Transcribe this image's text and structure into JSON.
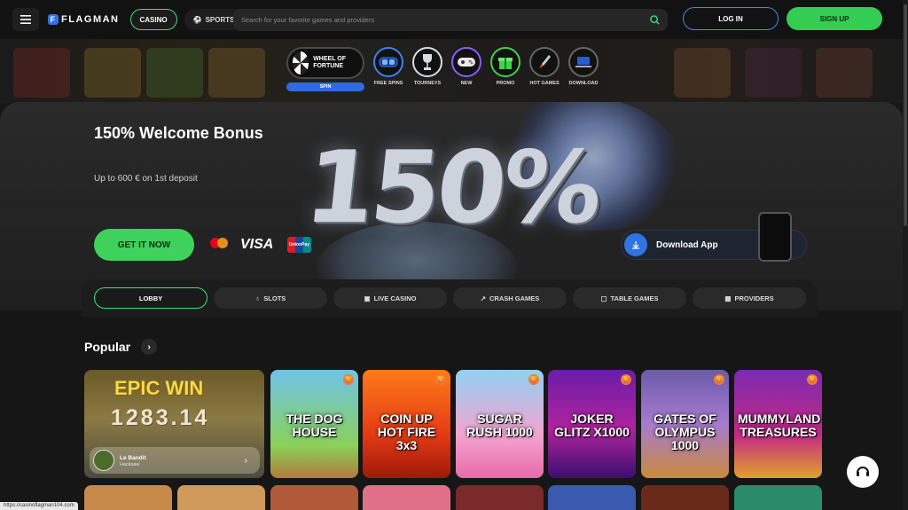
{
  "header": {
    "logo_text": "FLAGMAN",
    "logo_letter": "F",
    "casino_label": "CASINO",
    "sports_label": "SPORTS",
    "search_placeholder": "Search for your favorite games and providers",
    "login_label": "LOG IN",
    "signup_label": "SIGN UP"
  },
  "quick_nav": {
    "wheel_title": "WHEEL OF FORTUNE",
    "wheel_button": "SPIN",
    "items": [
      {
        "label": "FREE SPINS",
        "icon": "goggles-icon",
        "color": "#3b82f6"
      },
      {
        "label": "TOURNEYS",
        "icon": "trophy-icon",
        "color": "#d7dde6"
      },
      {
        "label": "NEW",
        "icon": "gamepad-icon",
        "color": "#8b5cf6"
      },
      {
        "label": "PROMO",
        "icon": "gift-icon",
        "color": "#44d04a"
      },
      {
        "label": "HOT GAMES",
        "icon": "rocket-icon",
        "color": "#9aa3ad"
      },
      {
        "label": "DOWNLOAD",
        "icon": "laptop-icon",
        "color": "#3b82f6"
      }
    ]
  },
  "banner": {
    "title": "150% Welcome Bonus",
    "subtitle": "Up to 600 € on 1st deposit",
    "big_text": "150%",
    "cta_label": "GET IT NOW",
    "visa_text": "VISA",
    "unionpay_text": "UnionPay",
    "download_label": "Download App"
  },
  "tabs": [
    {
      "label": "LOBBY",
      "icon": ""
    },
    {
      "label": "SLOTS",
      "icon": "♁"
    },
    {
      "label": "LIVE CASINO",
      "icon": "▣"
    },
    {
      "label": "CRASH GAMES",
      "icon": "↗"
    },
    {
      "label": "TABLE GAMES",
      "icon": "▢"
    },
    {
      "label": "PROVIDERS",
      "icon": "▦"
    }
  ],
  "popular": {
    "title": "Popular",
    "feature": {
      "headline": "EPIC WIN",
      "amount": "1283.14",
      "game_name": "Le Bandit",
      "provider": "Hacksaw"
    },
    "cards": [
      {
        "name": "THE DOG HOUSE",
        "bg": "linear-gradient(180deg,#6ec3e8,#8bd05a 70%,#b07a3c)"
      },
      {
        "name": "COIN UP HOT FIRE 3x3",
        "bg": "linear-gradient(180deg,#ff7a1a,#e43a14 60%,#9e1a0a)"
      },
      {
        "name": "SUGAR RUSH 1000",
        "bg": "linear-gradient(180deg,#8fd1f2,#f4a4d0 60%,#e86aa8)"
      },
      {
        "name": "JOKER GLITZ X1000",
        "bg": "linear-gradient(180deg,#6a1da8,#b0249e 55%,#3a0e6e)"
      },
      {
        "name": "GATES OF OLYMPUS 1000",
        "bg": "linear-gradient(180deg,#6a5aa8,#a77bd0 50%,#c98a3a)"
      },
      {
        "name": "MUMMYLAND TREASURES",
        "bg": "linear-gradient(180deg,#7a2ab0,#c42a86 60%,#e0a22a)"
      }
    ]
  },
  "status_url": "https://casinoflagman104.com"
}
